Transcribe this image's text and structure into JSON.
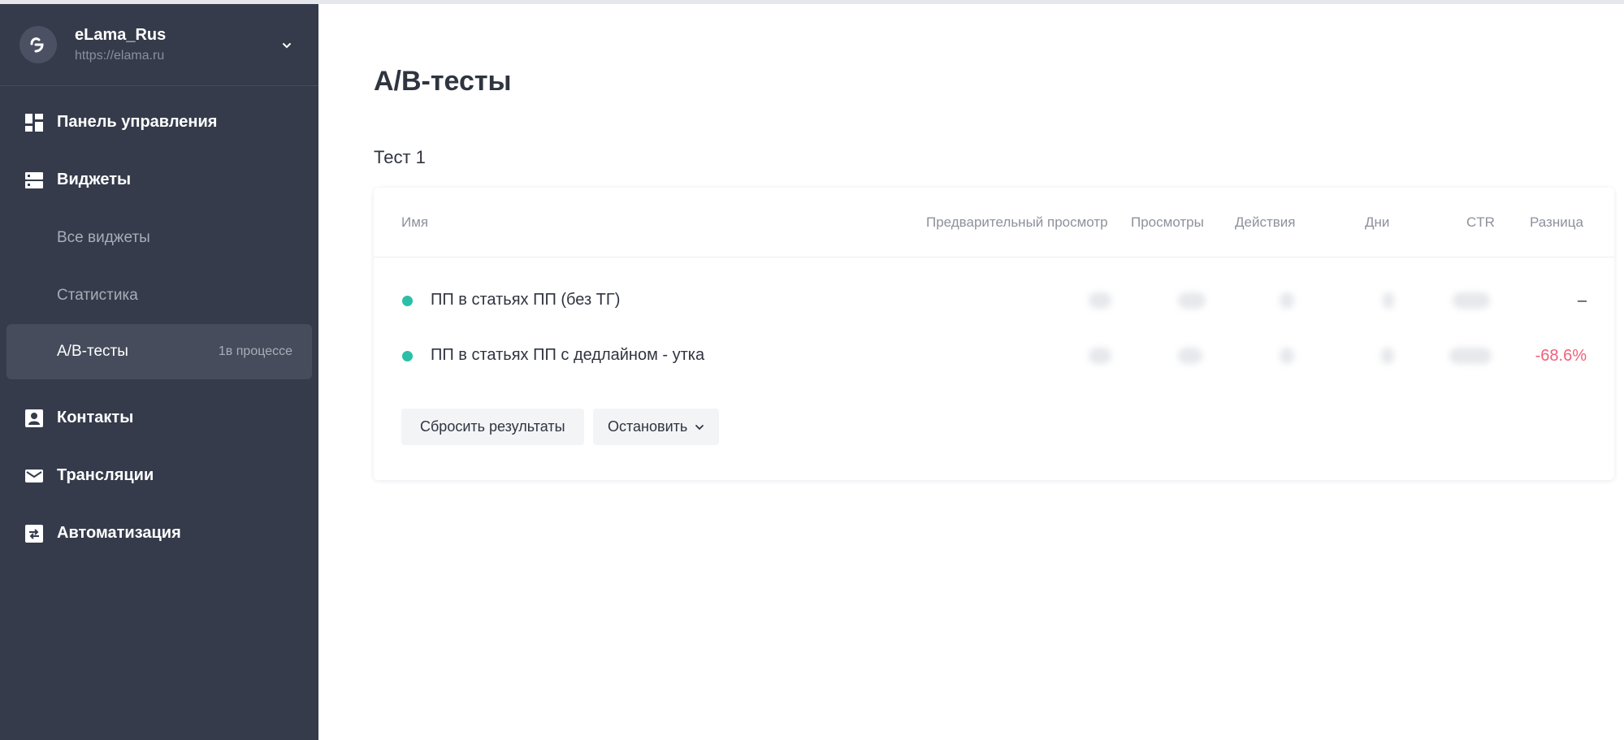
{
  "account": {
    "name": "eLama_Rus",
    "url": "https://elama.ru"
  },
  "sidebar": {
    "items": [
      {
        "label": "Панель управления",
        "icon": "dashboard-icon"
      },
      {
        "label": "Виджеты",
        "icon": "widgets-icon"
      },
      {
        "label": "Все виджеты"
      },
      {
        "label": "Статистика"
      },
      {
        "label": "A/B-тесты",
        "badge": "1в процессе",
        "active": true
      },
      {
        "label": "Контакты",
        "icon": "contact-card-icon"
      },
      {
        "label": "Трансляции",
        "icon": "envelope-icon"
      },
      {
        "label": "Автоматизация",
        "icon": "automation-icon"
      }
    ]
  },
  "page": {
    "title": "A/B-тесты",
    "test_name": "Тест 1"
  },
  "table": {
    "columns": [
      "Имя",
      "Предварительный просмотр",
      "Просмотры",
      "Действия",
      "Дни",
      "CTR",
      "Разница"
    ],
    "rows": [
      {
        "name": "ПП в статьях ПП (без ТГ)",
        "difference": "–"
      },
      {
        "name": "ПП в статьях ПП с дедлайном - утка",
        "difference": "-68.6%"
      }
    ]
  },
  "buttons": {
    "reset": "Сбросить результаты",
    "stop": "Остановить"
  },
  "colors": {
    "sidebar_bg": "#353b4b",
    "status_dot": "#2bbfa8",
    "negative": "#f0607a"
  }
}
